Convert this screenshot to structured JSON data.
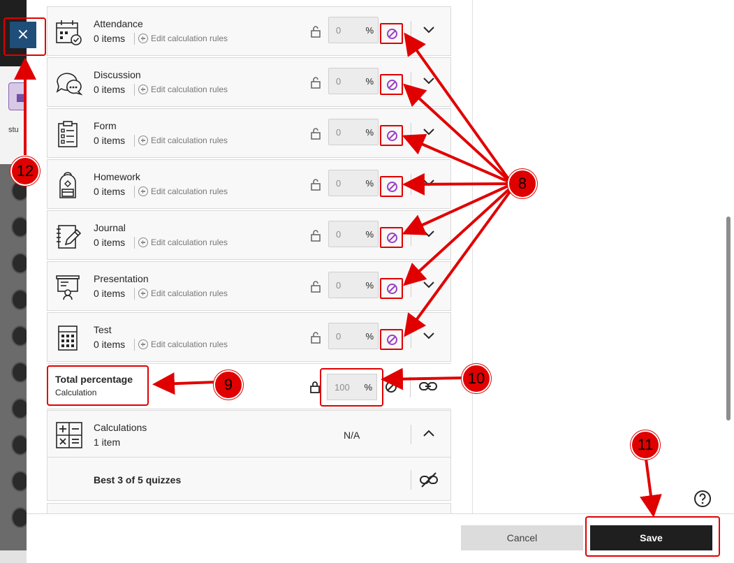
{
  "close": {
    "label": "×"
  },
  "background": {
    "stud_text": "stu"
  },
  "categories": [
    {
      "name": "Attendance",
      "count": "0 items",
      "edit": "Edit calculation rules",
      "value": "0",
      "unit": "%",
      "icon": "calendar-check-icon"
    },
    {
      "name": "Discussion",
      "count": "0 items",
      "edit": "Edit calculation rules",
      "value": "0",
      "unit": "%",
      "icon": "chat-bubbles-icon"
    },
    {
      "name": "Form",
      "count": "0 items",
      "edit": "Edit calculation rules",
      "value": "0",
      "unit": "%",
      "icon": "clipboard-list-icon"
    },
    {
      "name": "Homework",
      "count": "0 items",
      "edit": "Edit calculation rules",
      "value": "0",
      "unit": "%",
      "icon": "backpack-icon"
    },
    {
      "name": "Journal",
      "count": "0 items",
      "edit": "Edit calculation rules",
      "value": "0",
      "unit": "%",
      "icon": "notebook-pen-icon"
    },
    {
      "name": "Presentation",
      "count": "0 items",
      "edit": "Edit calculation rules",
      "value": "0",
      "unit": "%",
      "icon": "easel-icon"
    },
    {
      "name": "Test",
      "count": "0 items",
      "edit": "Edit calculation rules",
      "value": "0",
      "unit": "%",
      "icon": "test-grid-icon"
    }
  ],
  "total": {
    "title": "Total percentage",
    "subtitle": "Calculation",
    "value": "100",
    "unit": "%"
  },
  "calculations": {
    "name": "Calculations",
    "count": "1 item",
    "value": "N/A"
  },
  "best": {
    "label": "Best 3 of 5 quizzes"
  },
  "footer": {
    "cancel": "Cancel",
    "save": "Save"
  },
  "annotations": {
    "b8": "8",
    "b9": "9",
    "b10": "10",
    "b11": "11",
    "b12": "12"
  },
  "colors": {
    "annotation": "#e00000",
    "exclude_icon": "#9b3fc4",
    "close_button": "#1f4e79",
    "save_button": "#1f1f1f"
  }
}
